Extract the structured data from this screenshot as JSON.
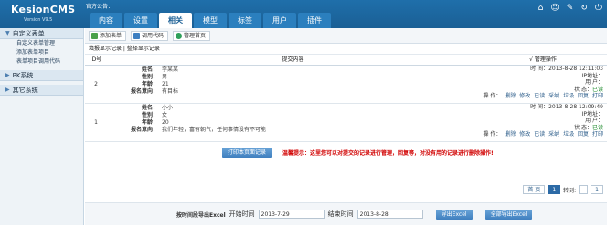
{
  "header": {
    "logo_name": "KesionCMS",
    "logo_version": "Version V9.5",
    "notice_label": "官方公告：",
    "tabs": [
      "内容",
      "设置",
      "相关",
      "模型",
      "标签",
      "用户",
      "插件"
    ],
    "active_tab_index": 2
  },
  "top_icons": [
    "home-icon",
    "user-icon",
    "tools-icon",
    "refresh-icon",
    "power-icon"
  ],
  "sidebar": {
    "groups": [
      {
        "title": "自定义表单",
        "items": [
          "自定义表单管理",
          "添加表单项目",
          "表单项目调用代码"
        ]
      },
      {
        "title": "PK系统",
        "items": []
      },
      {
        "title": "其它系统",
        "items": []
      }
    ]
  },
  "toolbar": {
    "buttons": [
      "添加表单",
      "调用代码",
      "管理首页"
    ]
  },
  "breadcrumb": "填报显示记录 | 整择显示记录",
  "table": {
    "headers": {
      "id": "ID号",
      "content": "提交内容",
      "ops": "√ 管理操作"
    },
    "field_labels": {
      "name": "姓名：",
      "gender": "性别：",
      "age": "年龄：",
      "reason": "报名意向："
    },
    "meta_labels": {
      "time": "时 间：",
      "ip": "IP地址：",
      "user": "用 户：",
      "status": "状 态：",
      "ops": "操 作："
    },
    "rows": [
      {
        "id": "2",
        "name": "李某某",
        "gender": "男",
        "age": "21",
        "reason": "有目标",
        "time": "2013-8-28 12:11:03",
        "status": "已读",
        "ops": [
          "删除",
          "修改",
          "已读",
          "采纳",
          "垃圾",
          "回复",
          "打印"
        ]
      },
      {
        "id": "1",
        "name": "小小",
        "gender": "女",
        "age": "20",
        "reason": "我们年轻，富有朝气，任何事情没有不可能",
        "time": "2013-8-28 12:09:49",
        "status": "已读",
        "ops": [
          "删除",
          "修改",
          "已读",
          "采纳",
          "垃圾",
          "回复",
          "打印"
        ]
      }
    ]
  },
  "actions": {
    "print_button": "打印本页面记录",
    "warning": "温馨提示：这里您可以对提交的记录进行管理，回复等，对没有用的记录进行删除操作!"
  },
  "pager": {
    "first": "首 页",
    "current": "1",
    "jump_label": "转到:",
    "last": "1"
  },
  "export": {
    "label": "按时间段导出Excel",
    "start_label": "开始时间",
    "start_date": "2013-7-29",
    "end_label": "结束时间",
    "end_date": "2013-8-28",
    "export_button": "导出Excel",
    "export_all_button": "全部导出Excel"
  }
}
